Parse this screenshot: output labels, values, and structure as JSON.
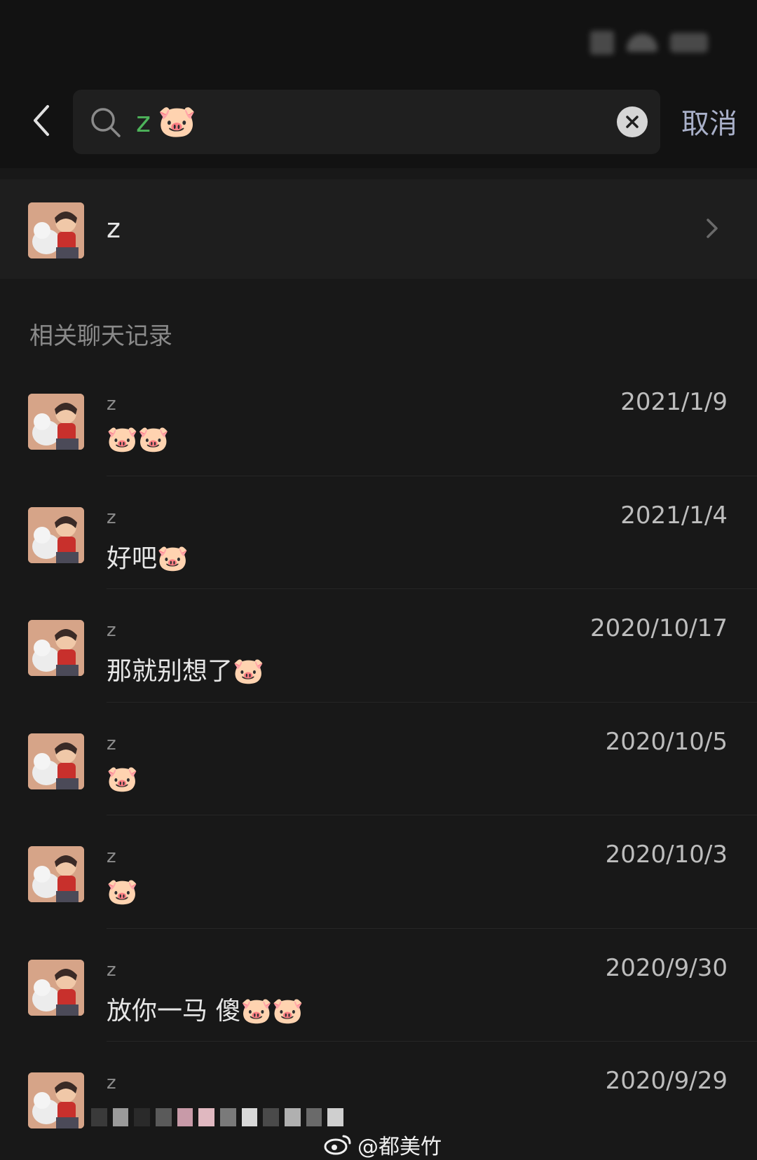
{
  "search": {
    "query_text": "z",
    "query_emoji": "🐷",
    "cancel_label": "取消"
  },
  "contact": {
    "name": "z"
  },
  "section_title": "相关聊天记录",
  "results": [
    {
      "sender": "z",
      "date": "2021/1/9",
      "message": "🐷🐷"
    },
    {
      "sender": "z",
      "date": "2021/1/4",
      "message": "好吧🐷"
    },
    {
      "sender": "z",
      "date": "2020/10/17",
      "message": "那就别想了🐷"
    },
    {
      "sender": "z",
      "date": "2020/10/5",
      "message": "🐷"
    },
    {
      "sender": "z",
      "date": "2020/10/3",
      "message": "🐷"
    },
    {
      "sender": "z",
      "date": "2020/9/30",
      "message": "放你一马 傻🐷🐷"
    },
    {
      "sender": "z",
      "date": "2020/9/29",
      "message": ""
    }
  ],
  "watermark": "@都美竹",
  "icons": {
    "back": "chevron-left-icon",
    "search": "search-icon",
    "clear": "clear-x-icon",
    "disclosure": "chevron-right-icon",
    "watermark_logo": "weibo-logo-icon"
  },
  "colors": {
    "background": "#181818",
    "query_green": "#4db35a",
    "cancel_blue": "#a9b0c9"
  }
}
